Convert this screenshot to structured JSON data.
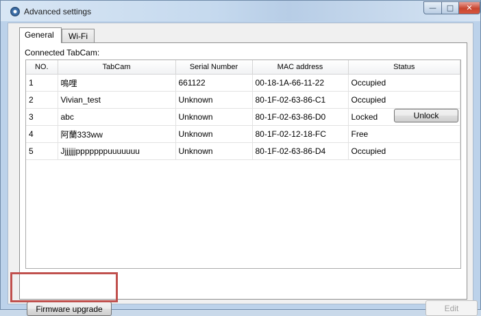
{
  "window": {
    "title": "Advanced settings",
    "controls": {
      "minimize": "—",
      "maximize": "□",
      "close": "✕"
    }
  },
  "tabs": [
    {
      "label": "General",
      "active": true
    },
    {
      "label": "Wi-Fi",
      "active": false
    }
  ],
  "section_label": "Connected TabCam:",
  "table": {
    "columns": [
      "NO.",
      "TabCam",
      "Serial Number",
      "MAC address",
      "Status"
    ],
    "rows": [
      {
        "no": "1",
        "tabcam": "嗚哩",
        "serial": "661122",
        "mac": "00-18-1A-66-11-22",
        "status": "Occupied"
      },
      {
        "no": "2",
        "tabcam": "Vivian_test",
        "serial": "Unknown",
        "mac": "80-1F-02-63-86-C1",
        "status": "Occupied"
      },
      {
        "no": "3",
        "tabcam": "abc",
        "serial": "Unknown",
        "mac": "80-1F-02-63-86-D0",
        "status": "Locked",
        "action": "Unlock"
      },
      {
        "no": "4",
        "tabcam": "阿蘭333ww",
        "serial": "Unknown",
        "mac": "80-1F-02-12-18-FC",
        "status": "Free"
      },
      {
        "no": "5",
        "tabcam": "Jjjjjjjpppppppuuuuuuu",
        "serial": "Unknown",
        "mac": "80-1F-02-63-86-D4",
        "status": "Occupied"
      }
    ]
  },
  "buttons": {
    "firmware_upgrade": "Firmware upgrade",
    "edit": "Edit"
  },
  "colors": {
    "highlight": "#c0504d",
    "close_button": "#c8452f"
  },
  "icons": {
    "app": "settings-gear-icon"
  }
}
